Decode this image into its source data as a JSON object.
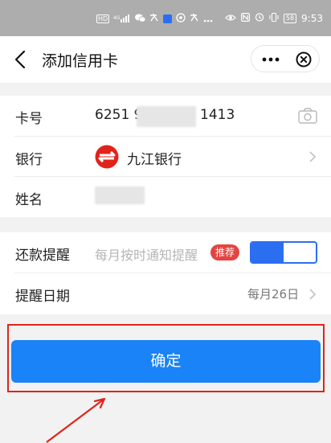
{
  "status_bar": {
    "hd_badge": "HD",
    "signal_text": "4G",
    "battery": "58",
    "time": "9:53"
  },
  "nav": {
    "title": "添加信用卡",
    "more_icon": "more-dots-icon",
    "close_icon": "close-circle-icon"
  },
  "form": {
    "card_no_label": "卡号",
    "card_no_prefix": "6251 9",
    "card_no_suffix": "1413",
    "bank_label": "银行",
    "bank_name": "九江银行",
    "name_label": "姓名"
  },
  "reminder": {
    "label": "还款提醒",
    "hint": "每月按时通知提醒",
    "tag": "推荐",
    "enabled": true,
    "date_label": "提醒日期",
    "date_value": "每月26日"
  },
  "confirm_label": "确定",
  "colors": {
    "accent": "#1a83f7",
    "highlight_frame": "#e0241b",
    "tag_red": "#e64340"
  }
}
